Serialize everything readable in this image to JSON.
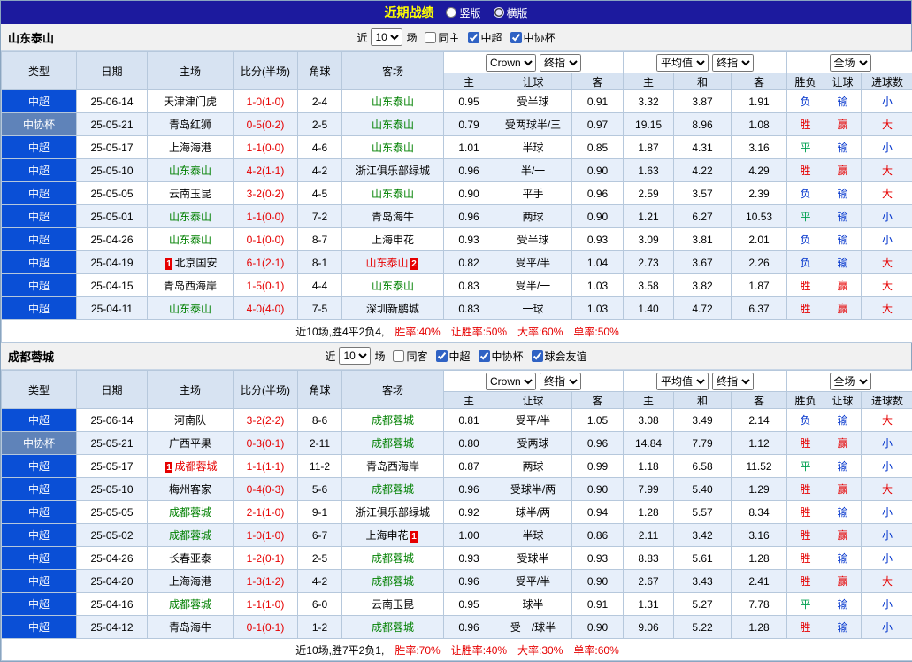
{
  "topbar": {
    "title": "近期战绩",
    "radios": [
      {
        "label": "竖版",
        "checked": false
      },
      {
        "label": "横版",
        "checked": true
      }
    ]
  },
  "table_header": {
    "static_cols": [
      "类型",
      "日期",
      "主场",
      "比分(半场)",
      "角球",
      "客场"
    ],
    "sub_cols": [
      "主",
      "让球",
      "客",
      "主",
      "和",
      "客",
      "胜负",
      "让球",
      "进球数"
    ],
    "group1_selects": [
      "Crown",
      "终指"
    ],
    "group2_selects": [
      "平均值",
      "终指"
    ],
    "group3_selects": [
      "全场"
    ]
  },
  "sections": [
    {
      "team": "山东泰山",
      "filter": {
        "near": "近",
        "count": "10",
        "matches": "场",
        "checkboxes": [
          {
            "label": "同主",
            "checked": false
          },
          {
            "label": "中超",
            "checked": true
          },
          {
            "label": "中协杯",
            "checked": true
          }
        ]
      },
      "rows": [
        {
          "league": "中超",
          "kind": "csl",
          "date": "25-06-14",
          "home": {
            "name": "天津津门虎",
            "color": "black"
          },
          "score": "1-0(1-0)",
          "corners": "2-4",
          "away": {
            "name": "山东泰山",
            "color": "green"
          },
          "crown": [
            "0.95",
            "受半球",
            "0.91"
          ],
          "avg": [
            "3.32",
            "3.87",
            "1.91"
          ],
          "res": [
            "负",
            "输",
            "小"
          ],
          "resc": [
            "blue",
            "blue",
            "blue"
          ]
        },
        {
          "league": "中协杯",
          "kind": "cup",
          "date": "25-05-21",
          "home": {
            "name": "青岛红狮",
            "color": "black"
          },
          "score": "0-5(0-2)",
          "corners": "2-5",
          "away": {
            "name": "山东泰山",
            "color": "green"
          },
          "crown": [
            "0.79",
            "受两球半/三",
            "0.97"
          ],
          "avg": [
            "19.15",
            "8.96",
            "1.08"
          ],
          "res": [
            "胜",
            "赢",
            "大"
          ],
          "resc": [
            "red",
            "red",
            "red"
          ]
        },
        {
          "league": "中超",
          "kind": "csl",
          "date": "25-05-17",
          "home": {
            "name": "上海海港",
            "color": "black"
          },
          "score": "1-1(0-0)",
          "corners": "4-6",
          "away": {
            "name": "山东泰山",
            "color": "green"
          },
          "crown": [
            "1.01",
            "半球",
            "0.85"
          ],
          "avg": [
            "1.87",
            "4.31",
            "3.16"
          ],
          "res": [
            "平",
            "输",
            "小"
          ],
          "resc": [
            "green",
            "blue",
            "blue"
          ]
        },
        {
          "league": "中超",
          "kind": "csl",
          "date": "25-05-10",
          "home": {
            "name": "山东泰山",
            "color": "green"
          },
          "score": "4-2(1-1)",
          "corners": "4-2",
          "away": {
            "name": "浙江俱乐部绿城",
            "color": "black"
          },
          "crown": [
            "0.96",
            "半/一",
            "0.90"
          ],
          "avg": [
            "1.63",
            "4.22",
            "4.29"
          ],
          "res": [
            "胜",
            "赢",
            "大"
          ],
          "resc": [
            "red",
            "red",
            "red"
          ]
        },
        {
          "league": "中超",
          "kind": "csl",
          "date": "25-05-05",
          "home": {
            "name": "云南玉昆",
            "color": "black"
          },
          "score": "3-2(0-2)",
          "corners": "4-5",
          "away": {
            "name": "山东泰山",
            "color": "green"
          },
          "crown": [
            "0.90",
            "平手",
            "0.96"
          ],
          "avg": [
            "2.59",
            "3.57",
            "2.39"
          ],
          "res": [
            "负",
            "输",
            "大"
          ],
          "resc": [
            "blue",
            "blue",
            "red"
          ]
        },
        {
          "league": "中超",
          "kind": "csl",
          "date": "25-05-01",
          "home": {
            "name": "山东泰山",
            "color": "green"
          },
          "score": "1-1(0-0)",
          "corners": "7-2",
          "away": {
            "name": "青岛海牛",
            "color": "black"
          },
          "crown": [
            "0.96",
            "两球",
            "0.90"
          ],
          "avg": [
            "1.21",
            "6.27",
            "10.53"
          ],
          "res": [
            "平",
            "输",
            "小"
          ],
          "resc": [
            "green",
            "blue",
            "blue"
          ]
        },
        {
          "league": "中超",
          "kind": "csl",
          "date": "25-04-26",
          "home": {
            "name": "山东泰山",
            "color": "green"
          },
          "score": "0-1(0-0)",
          "corners": "8-7",
          "away": {
            "name": "上海申花",
            "color": "black"
          },
          "crown": [
            "0.93",
            "受半球",
            "0.93"
          ],
          "avg": [
            "3.09",
            "3.81",
            "2.01"
          ],
          "res": [
            "负",
            "输",
            "小"
          ],
          "resc": [
            "blue",
            "blue",
            "blue"
          ]
        },
        {
          "league": "中超",
          "kind": "csl",
          "date": "25-04-19",
          "home": {
            "name": "北京国安",
            "color": "black",
            "badge": "1",
            "badgePos": "before"
          },
          "score": "6-1(2-1)",
          "corners": "8-1",
          "away": {
            "name": "山东泰山",
            "color": "red",
            "badge": "2",
            "badgePos": "after"
          },
          "crown": [
            "0.82",
            "受平/半",
            "1.04"
          ],
          "avg": [
            "2.73",
            "3.67",
            "2.26"
          ],
          "res": [
            "负",
            "输",
            "大"
          ],
          "resc": [
            "blue",
            "blue",
            "red"
          ]
        },
        {
          "league": "中超",
          "kind": "csl",
          "date": "25-04-15",
          "home": {
            "name": "青岛西海岸",
            "color": "black"
          },
          "score": "1-5(0-1)",
          "corners": "4-4",
          "away": {
            "name": "山东泰山",
            "color": "green"
          },
          "crown": [
            "0.83",
            "受半/一",
            "1.03"
          ],
          "avg": [
            "3.58",
            "3.82",
            "1.87"
          ],
          "res": [
            "胜",
            "赢",
            "大"
          ],
          "resc": [
            "red",
            "red",
            "red"
          ]
        },
        {
          "league": "中超",
          "kind": "csl",
          "date": "25-04-11",
          "home": {
            "name": "山东泰山",
            "color": "green"
          },
          "score": "4-0(4-0)",
          "corners": "7-5",
          "away": {
            "name": "深圳新鹏城",
            "color": "black"
          },
          "crown": [
            "0.83",
            "一球",
            "1.03"
          ],
          "avg": [
            "1.40",
            "4.72",
            "6.37"
          ],
          "res": [
            "胜",
            "赢",
            "大"
          ],
          "resc": [
            "red",
            "red",
            "red"
          ]
        }
      ],
      "summary": {
        "prefix": "近10场,胜4平2负4,",
        "stats": [
          "胜率:40%",
          "让胜率:50%",
          "大率:60%",
          "单率:50%"
        ]
      }
    },
    {
      "team": "成都蓉城",
      "filter": {
        "near": "近",
        "count": "10",
        "matches": "场",
        "checkboxes": [
          {
            "label": "同客",
            "checked": false
          },
          {
            "label": "中超",
            "checked": true
          },
          {
            "label": "中协杯",
            "checked": true
          },
          {
            "label": "球会友谊",
            "checked": true
          }
        ]
      },
      "rows": [
        {
          "league": "中超",
          "kind": "csl",
          "date": "25-06-14",
          "home": {
            "name": "河南队",
            "color": "black"
          },
          "score": "3-2(2-2)",
          "corners": "8-6",
          "away": {
            "name": "成都蓉城",
            "color": "green"
          },
          "crown": [
            "0.81",
            "受平/半",
            "1.05"
          ],
          "avg": [
            "3.08",
            "3.49",
            "2.14"
          ],
          "res": [
            "负",
            "输",
            "大"
          ],
          "resc": [
            "blue",
            "blue",
            "red"
          ]
        },
        {
          "league": "中协杯",
          "kind": "cup",
          "date": "25-05-21",
          "home": {
            "name": "广西平果",
            "color": "black"
          },
          "score": "0-3(0-1)",
          "corners": "2-11",
          "away": {
            "name": "成都蓉城",
            "color": "green"
          },
          "crown": [
            "0.80",
            "受两球",
            "0.96"
          ],
          "avg": [
            "14.84",
            "7.79",
            "1.12"
          ],
          "res": [
            "胜",
            "赢",
            "小"
          ],
          "resc": [
            "red",
            "red",
            "blue"
          ]
        },
        {
          "league": "中超",
          "kind": "csl",
          "date": "25-05-17",
          "home": {
            "name": "成都蓉城",
            "color": "red",
            "badge": "1",
            "badgePos": "before"
          },
          "score": "1-1(1-1)",
          "corners": "11-2",
          "away": {
            "name": "青岛西海岸",
            "color": "black"
          },
          "crown": [
            "0.87",
            "两球",
            "0.99"
          ],
          "avg": [
            "1.18",
            "6.58",
            "11.52"
          ],
          "res": [
            "平",
            "输",
            "小"
          ],
          "resc": [
            "green",
            "blue",
            "blue"
          ]
        },
        {
          "league": "中超",
          "kind": "csl",
          "date": "25-05-10",
          "home": {
            "name": "梅州客家",
            "color": "black"
          },
          "score": "0-4(0-3)",
          "corners": "5-6",
          "away": {
            "name": "成都蓉城",
            "color": "green"
          },
          "crown": [
            "0.96",
            "受球半/两",
            "0.90"
          ],
          "avg": [
            "7.99",
            "5.40",
            "1.29"
          ],
          "res": [
            "胜",
            "赢",
            "大"
          ],
          "resc": [
            "red",
            "red",
            "red"
          ]
        },
        {
          "league": "中超",
          "kind": "csl",
          "date": "25-05-05",
          "home": {
            "name": "成都蓉城",
            "color": "green"
          },
          "score": "2-1(1-0)",
          "corners": "9-1",
          "away": {
            "name": "浙江俱乐部绿城",
            "color": "black"
          },
          "crown": [
            "0.92",
            "球半/两",
            "0.94"
          ],
          "avg": [
            "1.28",
            "5.57",
            "8.34"
          ],
          "res": [
            "胜",
            "输",
            "小"
          ],
          "resc": [
            "red",
            "blue",
            "blue"
          ]
        },
        {
          "league": "中超",
          "kind": "csl",
          "date": "25-05-02",
          "home": {
            "name": "成都蓉城",
            "color": "green"
          },
          "score": "1-0(1-0)",
          "corners": "6-7",
          "away": {
            "name": "上海申花",
            "color": "black",
            "badge": "1",
            "badgePos": "after"
          },
          "crown": [
            "1.00",
            "半球",
            "0.86"
          ],
          "avg": [
            "2.11",
            "3.42",
            "3.16"
          ],
          "res": [
            "胜",
            "赢",
            "小"
          ],
          "resc": [
            "red",
            "red",
            "blue"
          ]
        },
        {
          "league": "中超",
          "kind": "csl",
          "date": "25-04-26",
          "home": {
            "name": "长春亚泰",
            "color": "black"
          },
          "score": "1-2(0-1)",
          "corners": "2-5",
          "away": {
            "name": "成都蓉城",
            "color": "green"
          },
          "crown": [
            "0.93",
            "受球半",
            "0.93"
          ],
          "avg": [
            "8.83",
            "5.61",
            "1.28"
          ],
          "res": [
            "胜",
            "输",
            "小"
          ],
          "resc": [
            "red",
            "blue",
            "blue"
          ]
        },
        {
          "league": "中超",
          "kind": "csl",
          "date": "25-04-20",
          "home": {
            "name": "上海海港",
            "color": "black"
          },
          "score": "1-3(1-2)",
          "corners": "4-2",
          "away": {
            "name": "成都蓉城",
            "color": "green"
          },
          "crown": [
            "0.96",
            "受平/半",
            "0.90"
          ],
          "avg": [
            "2.67",
            "3.43",
            "2.41"
          ],
          "res": [
            "胜",
            "赢",
            "大"
          ],
          "resc": [
            "red",
            "red",
            "red"
          ]
        },
        {
          "league": "中超",
          "kind": "csl",
          "date": "25-04-16",
          "home": {
            "name": "成都蓉城",
            "color": "green"
          },
          "score": "1-1(1-0)",
          "corners": "6-0",
          "away": {
            "name": "云南玉昆",
            "color": "black"
          },
          "crown": [
            "0.95",
            "球半",
            "0.91"
          ],
          "avg": [
            "1.31",
            "5.27",
            "7.78"
          ],
          "res": [
            "平",
            "输",
            "小"
          ],
          "resc": [
            "green",
            "blue",
            "blue"
          ]
        },
        {
          "league": "中超",
          "kind": "csl",
          "date": "25-04-12",
          "home": {
            "name": "青岛海牛",
            "color": "black"
          },
          "score": "0-1(0-1)",
          "corners": "1-2",
          "away": {
            "name": "成都蓉城",
            "color": "green"
          },
          "crown": [
            "0.96",
            "受一/球半",
            "0.90"
          ],
          "avg": [
            "9.06",
            "5.22",
            "1.28"
          ],
          "res": [
            "胜",
            "输",
            "小"
          ],
          "resc": [
            "red",
            "blue",
            "blue"
          ]
        }
      ],
      "summary": {
        "prefix": "近10场,胜7平2负1,",
        "stats": [
          "胜率:70%",
          "让胜率:40%",
          "大率:30%",
          "单率:60%"
        ]
      }
    }
  ]
}
